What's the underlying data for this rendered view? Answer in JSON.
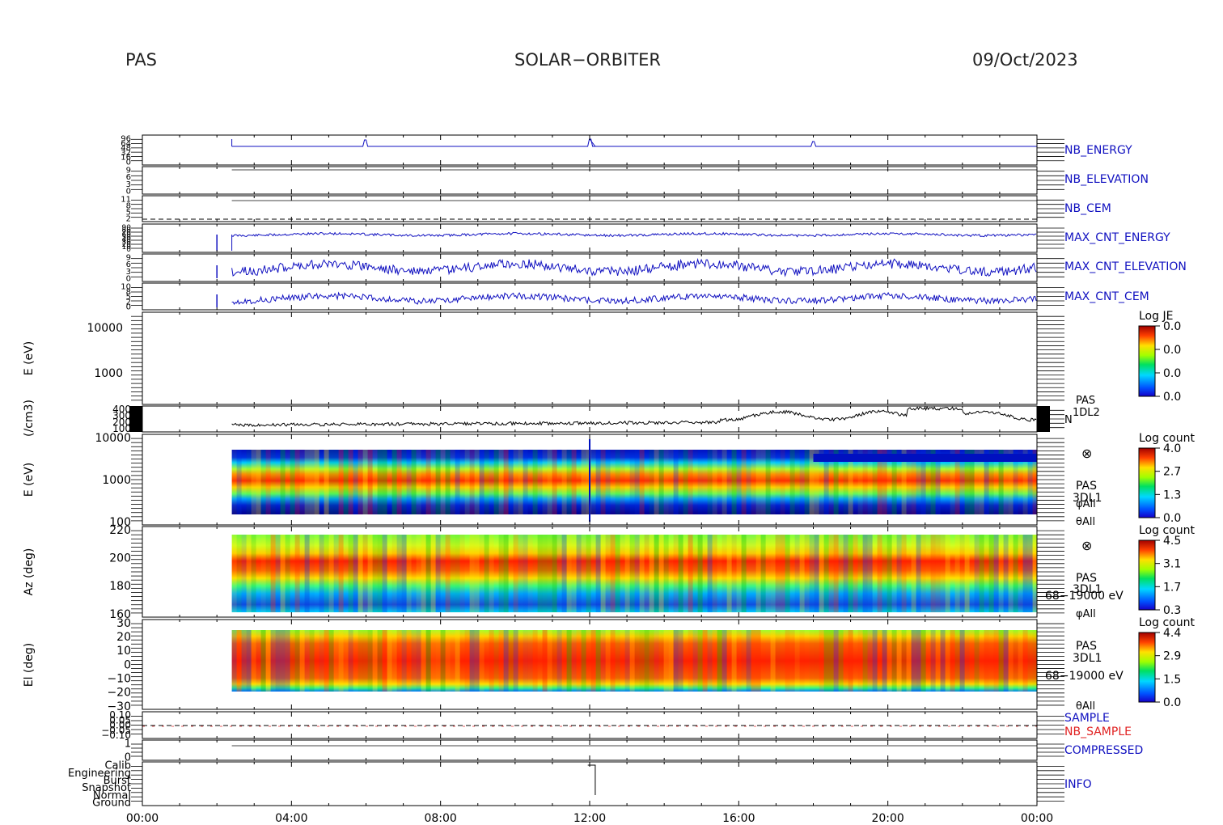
{
  "header": {
    "instrument": "PAS",
    "mission": "SOLAR−ORBITER",
    "date": "09/Oct/2023"
  },
  "colors": {
    "status_blue": "#1010c0",
    "sample_red": "#e02020",
    "axis": "#000000"
  },
  "chart_data": {
    "type": "table",
    "x_ticks": [
      "00:00",
      "04:00",
      "08:00",
      "12:00",
      "16:00",
      "20:00",
      "00:00"
    ],
    "xlim_hours": [
      0,
      24
    ],
    "status_panels": [
      {
        "name": "NB_ENERGY",
        "tick_labels": [
          "96",
          "64",
          "48",
          "32",
          "16",
          "0"
        ]
      },
      {
        "name": "NB_ELEVATION",
        "tick_labels": [
          "9",
          "6",
          "3",
          "0"
        ]
      },
      {
        "name": "NB_CEM",
        "tick_labels": [
          "11",
          "8",
          "5",
          "2"
        ]
      },
      {
        "name": "MAX_CNT_ENERGY",
        "tick_labels": [
          "90",
          "80",
          "70",
          "60",
          "50",
          "40",
          "30",
          "20",
          "10",
          "0"
        ]
      },
      {
        "name": "MAX_CNT_ELEVATION",
        "tick_labels": [
          "9",
          "6",
          "3",
          "0"
        ]
      },
      {
        "name": "MAX_CNT_CEM",
        "tick_labels": [
          "10",
          "8",
          "5",
          "2",
          "0"
        ]
      }
    ],
    "je_panel": {
      "ylabel": "E (eV)",
      "y_ticks": [
        "10000",
        "1000"
      ],
      "colorbar_title": "Log JE",
      "colorbar_ticks": [
        "0.0",
        "0.0",
        "0.0",
        "0.0"
      ]
    },
    "density_panel": {
      "ylabel": "(/cm3)",
      "y_ticks": [
        "400",
        "300",
        "200",
        "100"
      ],
      "labels": [
        "PAS",
        "1DL2",
        "N"
      ]
    },
    "spectrograms": [
      {
        "ylabel": "E (eV)",
        "y_ticks": [
          "10000",
          "1000",
          "100"
        ],
        "colorbar_title": "Log count",
        "colorbar_ticks": [
          "4.0",
          "2.7",
          "1.3",
          "0.0"
        ],
        "labels": [
          "⊗",
          "PAS",
          "3DL1",
          "φAll",
          "θAll"
        ]
      },
      {
        "ylabel": "Az (deg)",
        "y_ticks": [
          "220",
          "200",
          "180",
          "160"
        ],
        "colorbar_title": "Log count",
        "colorbar_ticks": [
          "4.5",
          "3.1",
          "1.7",
          "0.3"
        ],
        "labels": [
          "⊗",
          "PAS",
          "3DL1",
          "68−19000 eV",
          "φAll"
        ]
      },
      {
        "ylabel": "El (deg)",
        "y_ticks": [
          "30",
          "20",
          "10",
          "0",
          "−10",
          "−20",
          "−30"
        ],
        "colorbar_title": "Log count",
        "colorbar_ticks": [
          "4.4",
          "2.9",
          "1.5",
          "0.0"
        ],
        "labels": [
          "PAS",
          "3DL1",
          "68−19000 eV",
          "θAll"
        ]
      }
    ],
    "sample_panel": {
      "labels": [
        "SAMPLE",
        "NB_SAMPLE"
      ],
      "tick_labels": [
        "0.10",
        "0.05",
        "0.00",
        "−0.05",
        "−0.10"
      ]
    },
    "compressed_panel": {
      "labels": [
        "COMPRESSED"
      ],
      "tick_labels": [
        "1",
        "0"
      ]
    },
    "info_panel": {
      "labels": [
        "INFO"
      ],
      "tick_labels": [
        "Calib",
        "Engineering",
        "Burst",
        "Snapshot",
        "Normal",
        "Ground"
      ]
    }
  }
}
